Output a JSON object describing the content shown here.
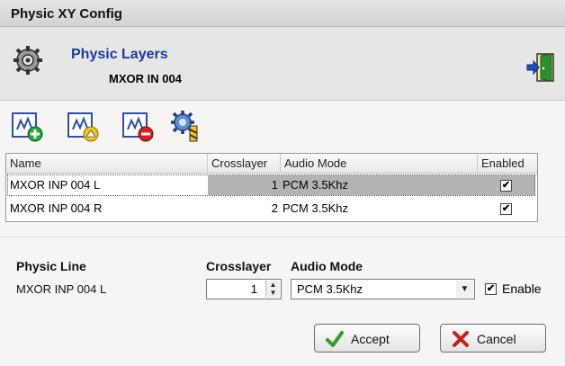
{
  "window": {
    "title": "Physic XY Config"
  },
  "header": {
    "title": "Physic Layers",
    "subtitle": "MXOR IN 004"
  },
  "table": {
    "columns": [
      "Name",
      "Crosslayer",
      "Audio Mode",
      "Enabled"
    ],
    "rows": [
      {
        "name": "MXOR INP 004 L",
        "crosslayer": "1",
        "audio_mode": "PCM 3.5Khz",
        "enabled": "✔"
      },
      {
        "name": "MXOR INP 004 R",
        "crosslayer": "2",
        "audio_mode": "PCM 3.5Khz",
        "enabled": "✔"
      }
    ]
  },
  "form": {
    "physic_line_label": "Physic Line",
    "physic_line_value": "MXOR INP 004 L",
    "crosslayer_label": "Crosslayer",
    "crosslayer_value": "1",
    "audio_mode_label": "Audio Mode",
    "audio_mode_value": "PCM 3.5Khz",
    "enable_label": "Enable",
    "enable_check": "✔"
  },
  "buttons": {
    "accept": "Accept",
    "cancel": "Cancel"
  },
  "colors": {
    "title_blue": "#1b3aa0",
    "accept_green": "#2e9e2e",
    "cancel_red": "#c81e1e"
  },
  "icons": [
    "gear-icon",
    "exit-door-icon",
    "add-line-icon",
    "edit-line-icon",
    "remove-line-icon",
    "config-gear-icon"
  ]
}
